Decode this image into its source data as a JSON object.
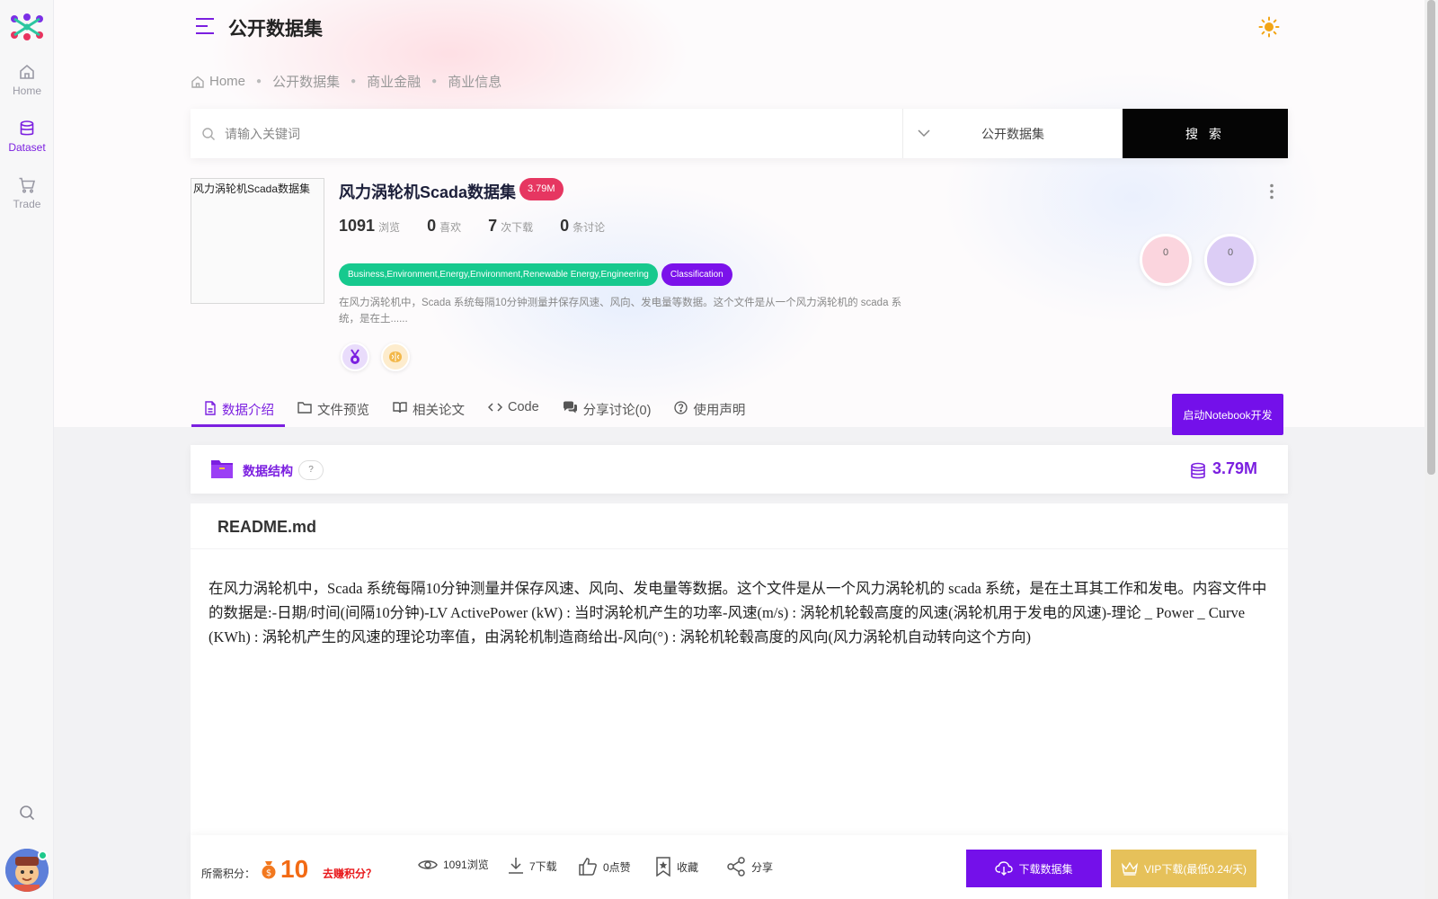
{
  "sidebar": {
    "items": [
      {
        "label": "Home",
        "icon": "home-icon"
      },
      {
        "label": "Dataset",
        "icon": "database-icon"
      },
      {
        "label": "Trade",
        "icon": "cart-icon"
      }
    ],
    "active": "Dataset"
  },
  "header": {
    "title": "公开数据集"
  },
  "breadcrumb": [
    "Home",
    "公开数据集",
    "商业金融",
    "商业信息"
  ],
  "search": {
    "placeholder": "请输入关键词",
    "value": "",
    "scope": "公开数据集",
    "button_label": "搜 索"
  },
  "dataset": {
    "thumbnail_alt": "风力涡轮机Scada数据集",
    "title": "风力涡轮机Scada数据集",
    "size": "3.79M",
    "stats": [
      {
        "value": "1091",
        "label": "浏览"
      },
      {
        "value": "0",
        "label": "喜欢"
      },
      {
        "value": "7",
        "label": "次下载"
      },
      {
        "value": "0",
        "label": "条讨论"
      }
    ],
    "circles": [
      "0",
      "0"
    ],
    "tags": [
      "Business,Environment,Energy,Environment,Renewable Energy,Engineering",
      "Classification"
    ],
    "description": "在风力涡轮机中，Scada 系统每隔10分钟测量并保存风速、风向、发电量等数据。这个文件是从一个风力涡轮机的 scada 系统，是在土......"
  },
  "tabs": [
    {
      "label": "数据介绍",
      "icon": "file-icon"
    },
    {
      "label": "文件预览",
      "icon": "folder-icon"
    },
    {
      "label": "相关论文",
      "icon": "book-icon"
    },
    {
      "label": "Code",
      "icon": "code-icon"
    },
    {
      "label": "分享讨论(0)",
      "icon": "chat-icon"
    },
    {
      "label": "使用声明",
      "icon": "question-icon"
    }
  ],
  "notebook_button": "启动Notebook开发",
  "structure": {
    "title": "数据结构",
    "help": "?",
    "total_size": "3.79M"
  },
  "readme": {
    "filename": "README.md",
    "content": "在风力涡轮机中，Scada 系统每隔10分钟测量并保存风速、风向、发电量等数据。这个文件是从一个风力涡轮机的 scada 系统，是在土耳其工作和发电。内容文件中的数据是:-日期/时间(间隔10分钟)-LV ActivePower (kW) : 当时涡轮机产生的功率-风速(m/s) : 涡轮机轮毂高度的风速(涡轮机用于发电的风速)-理论 _ Power _ Curve (KWh) : 涡轮机产生的风速的理论功率值，由涡轮机制造商给出-风向(°) : 涡轮机轮毂高度的风向(风力涡轮机自动转向这个方向)"
  },
  "bottom_bar": {
    "points_label": "所需积分：",
    "points": "10",
    "earn_link": "去赚积分？",
    "views": "1091浏览",
    "downloads": "7下载",
    "likes": "0点赞",
    "favorite": "收藏",
    "share": "分享",
    "download_button": "下载数据集",
    "vip_button": "VIP下载(最低0.24/天)"
  },
  "colors": {
    "accent": "#7b1fe0",
    "size_badge": "#e63661",
    "tag_green": "#17c98e",
    "vip_gold": "#e6c15a",
    "points_orange": "#f26a14"
  }
}
